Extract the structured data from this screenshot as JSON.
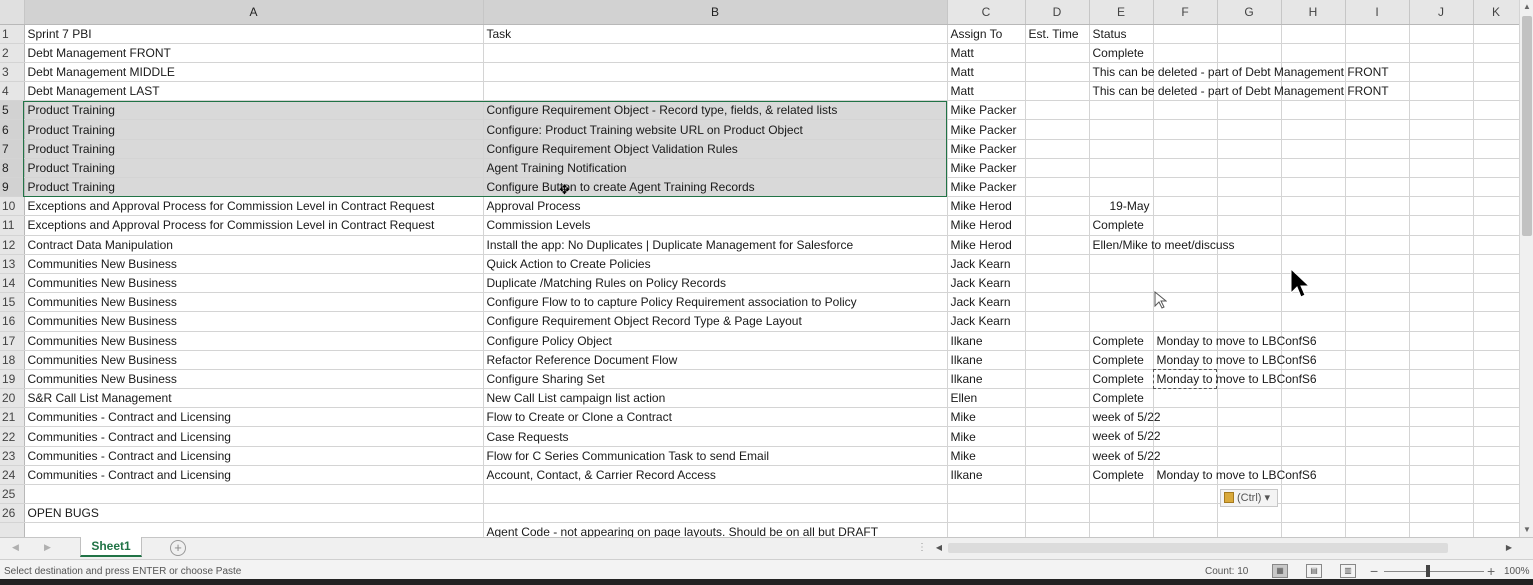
{
  "columns": [
    "A",
    "B",
    "C",
    "D",
    "E",
    "F",
    "G",
    "H",
    "I",
    "J",
    "K"
  ],
  "rows": [
    {
      "num": "1",
      "a": "Sprint 7 PBI",
      "b": "Task",
      "c": "Assign To",
      "d": "Est. Time",
      "e": "Status",
      "f": ""
    },
    {
      "num": "2",
      "a": "Debt Management FRONT",
      "b": "",
      "c": "Matt",
      "d": "",
      "e": "Complete",
      "f": ""
    },
    {
      "num": "3",
      "a": "Debt Management MIDDLE",
      "b": "",
      "c": "Matt",
      "d": "",
      "e": "This can be deleted - part of Debt Management FRONT",
      "f": ""
    },
    {
      "num": "4",
      "a": "Debt Management LAST",
      "b": "",
      "c": "Matt",
      "d": "",
      "e": "This can be deleted - part of Debt Management FRONT",
      "f": ""
    },
    {
      "num": "5",
      "a": "Product Training",
      "b": "Configure Requirement Object - Record type, fields, & related lists",
      "c": "Mike Packer",
      "d": "",
      "e": "",
      "f": ""
    },
    {
      "num": "6",
      "a": "Product Training",
      "b": "Configure: Product Training website URL on Product Object",
      "c": "Mike Packer",
      "d": "",
      "e": "",
      "f": ""
    },
    {
      "num": "7",
      "a": "Product Training",
      "b": "Configure Requirement Object Validation Rules",
      "c": "Mike Packer",
      "d": "",
      "e": "",
      "f": ""
    },
    {
      "num": "8",
      "a": "Product Training",
      "b": "Agent Training Notification",
      "c": "Mike Packer",
      "d": "",
      "e": "",
      "f": ""
    },
    {
      "num": "9",
      "a": "Product Training",
      "b": "Configure Button to create Agent Training Records",
      "c": "Mike Packer",
      "d": "",
      "e": "",
      "f": ""
    },
    {
      "num": "10",
      "a": "Exceptions and Approval Process for Commission Level in Contract Request",
      "b": "Approval Process",
      "c": "Mike Herod",
      "d": "",
      "e": "19-May",
      "f": ""
    },
    {
      "num": "11",
      "a": "Exceptions and Approval Process for Commission Level in Contract Request",
      "b": "Commission Levels",
      "c": "Mike Herod",
      "d": "",
      "e": "Complete",
      "f": ""
    },
    {
      "num": "12",
      "a": "Contract Data Manipulation",
      "b": "Install the app: No Duplicates | Duplicate Management for Salesforce",
      "c": "Mike Herod",
      "d": "",
      "e": "Ellen/Mike to meet/discuss",
      "f": ""
    },
    {
      "num": "13",
      "a": "Communities New Business",
      "b": "Quick Action to Create Policies",
      "c": "Jack Kearn",
      "d": "",
      "e": "",
      "f": ""
    },
    {
      "num": "14",
      "a": "Communities New Business",
      "b": "Duplicate /Matching Rules on Policy Records",
      "c": "Jack Kearn",
      "d": "",
      "e": "",
      "f": ""
    },
    {
      "num": "15",
      "a": "Communities New Business",
      "b": "Configure Flow to to capture Policy Requirement association to Policy",
      "c": "Jack Kearn",
      "d": "",
      "e": "",
      "f": ""
    },
    {
      "num": "16",
      "a": "Communities New Business",
      "b": "Configure Requirement Object Record Type & Page Layout",
      "c": "Jack Kearn",
      "d": "",
      "e": "",
      "f": ""
    },
    {
      "num": "17",
      "a": "Communities New Business",
      "b": "Configure Policy Object",
      "c": "Ilkane",
      "d": "",
      "e": "Complete",
      "f": "Monday to move to LBConfS6"
    },
    {
      "num": "18",
      "a": "Communities New Business",
      "b": "Refactor Reference Document Flow",
      "c": "Ilkane",
      "d": "",
      "e": "Complete",
      "f": "Monday to move to LBConfS6"
    },
    {
      "num": "19",
      "a": "Communities New Business",
      "b": "Configure Sharing Set",
      "c": "Ilkane",
      "d": "",
      "e": "Complete",
      "f": "Monday to move to LBConfS6"
    },
    {
      "num": "20",
      "a": "S&R Call List Management",
      "b": "New Call List campaign list action",
      "c": "Ellen",
      "d": "",
      "e": "Complete",
      "f": ""
    },
    {
      "num": "21",
      "a": "Communities - Contract and Licensing",
      "b": "Flow to Create or Clone a Contract",
      "c": "Mike",
      "d": "",
      "e": "week of 5/22",
      "f": ""
    },
    {
      "num": "22",
      "a": "Communities - Contract and Licensing",
      "b": "Case Requests",
      "c": "Mike",
      "d": "",
      "e": "week of 5/22",
      "f": ""
    },
    {
      "num": "23",
      "a": "Communities - Contract and Licensing",
      "b": "Flow for C Series Communication Task to send Email",
      "c": "Mike",
      "d": "",
      "e": "week of 5/22",
      "f": ""
    },
    {
      "num": "24",
      "a": "Communities - Contract and Licensing",
      "b": "Account, Contact, & Carrier Record Access",
      "c": "Ilkane",
      "d": "",
      "e": "Complete",
      "f": "Monday to move to LBConfS6"
    },
    {
      "num": "25",
      "a": "",
      "b": "",
      "c": "",
      "d": "",
      "e": "",
      "f": ""
    },
    {
      "num": "26",
      "a": "OPEN BUGS",
      "b": "",
      "c": "",
      "d": "",
      "e": "",
      "f": ""
    },
    {
      "num": "",
      "a": "",
      "b": "Agent Code - not appearing on page layouts. Should be on all but DRAFT",
      "c": "",
      "d": "",
      "e": "",
      "f": ""
    }
  ],
  "sheet_tab": "Sheet1",
  "paste_options": "(Ctrl)",
  "status": {
    "message": "Select destination and press ENTER or choose Paste",
    "count": "Count: 10",
    "zoom": "100%"
  },
  "colors": {
    "selection": "#d9d9d9",
    "accent": "#217346"
  }
}
